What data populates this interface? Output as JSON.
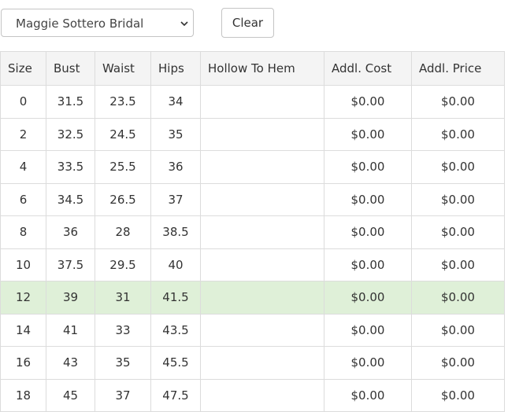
{
  "filter": {
    "selected_designer": "Maggie Sottero Bridal"
  },
  "actions": {
    "clear_label": "Clear"
  },
  "table": {
    "columns": [
      "Size",
      "Bust",
      "Waist",
      "Hips",
      "Hollow To Hem",
      "Addl. Cost",
      "Addl. Price"
    ],
    "highlight_color": "#dff0d8",
    "rows": [
      {
        "size": "0",
        "bust": "31.5",
        "waist": "23.5",
        "hips": "34",
        "hollow_to_hem": "",
        "addl_cost": "$0.00",
        "addl_price": "$0.00",
        "highlighted": false
      },
      {
        "size": "2",
        "bust": "32.5",
        "waist": "24.5",
        "hips": "35",
        "hollow_to_hem": "",
        "addl_cost": "$0.00",
        "addl_price": "$0.00",
        "highlighted": false
      },
      {
        "size": "4",
        "bust": "33.5",
        "waist": "25.5",
        "hips": "36",
        "hollow_to_hem": "",
        "addl_cost": "$0.00",
        "addl_price": "$0.00",
        "highlighted": false
      },
      {
        "size": "6",
        "bust": "34.5",
        "waist": "26.5",
        "hips": "37",
        "hollow_to_hem": "",
        "addl_cost": "$0.00",
        "addl_price": "$0.00",
        "highlighted": false
      },
      {
        "size": "8",
        "bust": "36",
        "waist": "28",
        "hips": "38.5",
        "hollow_to_hem": "",
        "addl_cost": "$0.00",
        "addl_price": "$0.00",
        "highlighted": false
      },
      {
        "size": "10",
        "bust": "37.5",
        "waist": "29.5",
        "hips": "40",
        "hollow_to_hem": "",
        "addl_cost": "$0.00",
        "addl_price": "$0.00",
        "highlighted": false
      },
      {
        "size": "12",
        "bust": "39",
        "waist": "31",
        "hips": "41.5",
        "hollow_to_hem": "",
        "addl_cost": "$0.00",
        "addl_price": "$0.00",
        "highlighted": true
      },
      {
        "size": "14",
        "bust": "41",
        "waist": "33",
        "hips": "43.5",
        "hollow_to_hem": "",
        "addl_cost": "$0.00",
        "addl_price": "$0.00",
        "highlighted": false
      },
      {
        "size": "16",
        "bust": "43",
        "waist": "35",
        "hips": "45.5",
        "hollow_to_hem": "",
        "addl_cost": "$0.00",
        "addl_price": "$0.00",
        "highlighted": false
      },
      {
        "size": "18",
        "bust": "45",
        "waist": "37",
        "hips": "47.5",
        "hollow_to_hem": "",
        "addl_cost": "$0.00",
        "addl_price": "$0.00",
        "highlighted": false
      }
    ]
  }
}
